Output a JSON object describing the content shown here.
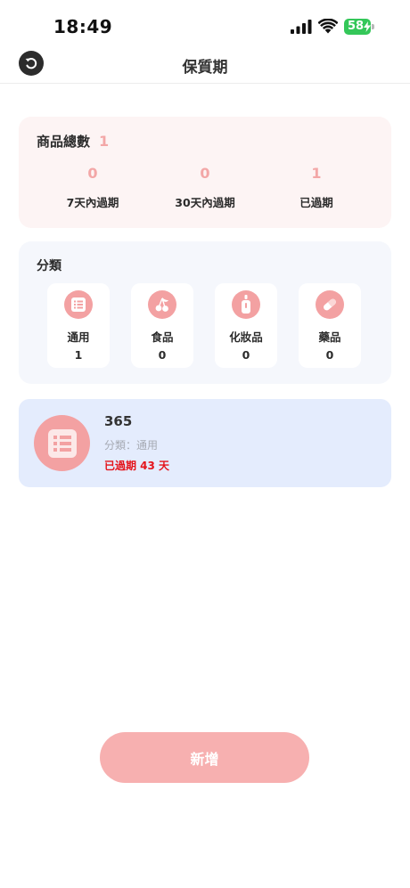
{
  "status_bar": {
    "time": "18:49",
    "battery": "58"
  },
  "nav": {
    "title": "保質期"
  },
  "summary": {
    "label": "商品總數",
    "total": "1",
    "stats": [
      {
        "value": "0",
        "label": "7天內過期"
      },
      {
        "value": "0",
        "label": "30天內過期"
      },
      {
        "value": "1",
        "label": "已過期"
      }
    ]
  },
  "categories": {
    "title": "分類",
    "items": [
      {
        "name": "通用",
        "count": "1",
        "icon": "list-icon"
      },
      {
        "name": "食品",
        "count": "0",
        "icon": "cherry-icon"
      },
      {
        "name": "化妝品",
        "count": "0",
        "icon": "bottle-icon"
      },
      {
        "name": "藥品",
        "count": "0",
        "icon": "pill-icon"
      }
    ]
  },
  "items": [
    {
      "name": "365",
      "category": "分類：通用",
      "expiry": "已過期 43 天",
      "icon": "list-icon"
    }
  ],
  "add_button": {
    "label": "新增"
  },
  "colors": {
    "accent_pink": "#f3a1a2",
    "expired_red": "#e4141b",
    "summary_bg": "#fdf4f4",
    "category_bg": "#f5f7fc",
    "item_bg": "#e4ecfd",
    "button_bg": "#f7b0b0"
  }
}
